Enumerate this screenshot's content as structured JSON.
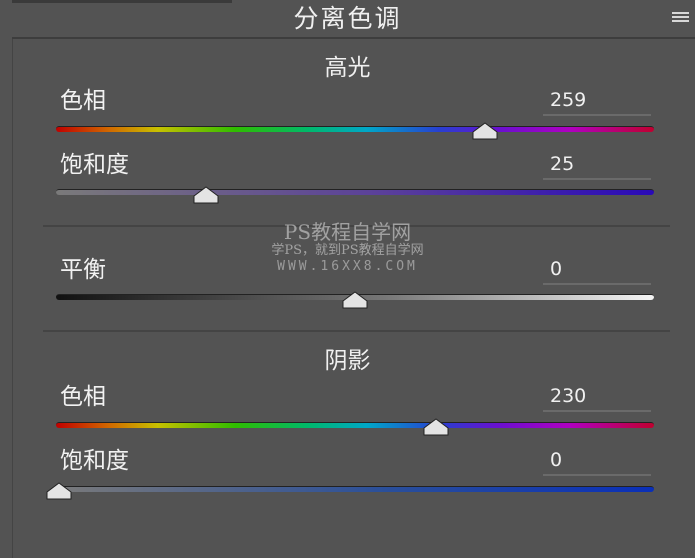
{
  "panel": {
    "title": "分离色调",
    "menu_icon": "hamburger-menu-icon"
  },
  "highlights": {
    "heading": "高光",
    "hue": {
      "label": "色相",
      "value": "259",
      "min": 0,
      "max": 360
    },
    "saturation": {
      "label": "饱和度",
      "value": "25",
      "min": 0,
      "max": 100
    }
  },
  "balance": {
    "label": "平衡",
    "value": "0",
    "min": -100,
    "max": 100
  },
  "shadows": {
    "heading": "阴影",
    "hue": {
      "label": "色相",
      "value": "230",
      "min": 0,
      "max": 360
    },
    "saturation": {
      "label": "饱和度",
      "value": "0",
      "min": 0,
      "max": 100
    }
  },
  "watermark": {
    "line1": "PS教程自学网",
    "line2": "学PS，就到PS教程自学网",
    "line3": "WWW.16XX8.COM"
  }
}
